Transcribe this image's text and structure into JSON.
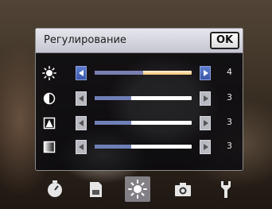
{
  "dialog": {
    "title": "Регулирование",
    "ok_label": "OK",
    "rows": [
      {
        "icon": "brightness-icon",
        "value": "4",
        "level": 0.5,
        "selected": true
      },
      {
        "icon": "contrast-icon",
        "value": "3",
        "level": 0.375,
        "selected": false
      },
      {
        "icon": "sharpness-icon",
        "value": "3",
        "level": 0.375,
        "selected": false
      },
      {
        "icon": "saturation-icon",
        "value": "3",
        "level": 0.375,
        "selected": false
      }
    ]
  },
  "toolbar": {
    "items": [
      {
        "icon": "timer-icon"
      },
      {
        "icon": "memory-card-icon"
      },
      {
        "icon": "brightness-icon",
        "selected": true
      },
      {
        "icon": "camera-icon"
      },
      {
        "icon": "settings-wrench-icon"
      }
    ]
  },
  "colors": {
    "slider_fill": "#6f80b8",
    "selected_track": "#f0c577",
    "arrow_active": "#3a55a8"
  }
}
